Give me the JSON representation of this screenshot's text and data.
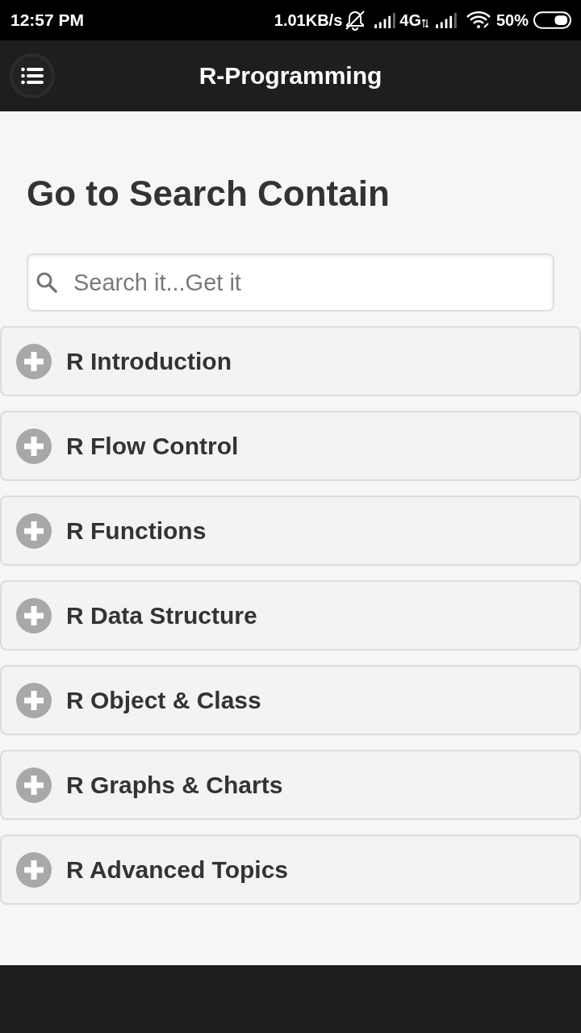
{
  "status_bar": {
    "time": "12:57 PM",
    "net_speed": "1.01KB/s",
    "network_type": "4G",
    "battery": "50%"
  },
  "app_bar": {
    "title": "R-Programming"
  },
  "heading": "Go to Search Contain",
  "search": {
    "placeholder": "Search it...Get it"
  },
  "sections": [
    {
      "label": "R Introduction",
      "expanded": false
    },
    {
      "label": "R Flow Control",
      "expanded": false
    },
    {
      "label": "R Functions",
      "expanded": false
    },
    {
      "label": "R Data Structure",
      "expanded": false
    },
    {
      "label": "R Object & Class",
      "expanded": false
    },
    {
      "label": "R Graphs & Charts",
      "expanded": false
    },
    {
      "label": "R Advanced Topics",
      "expanded": false
    }
  ]
}
